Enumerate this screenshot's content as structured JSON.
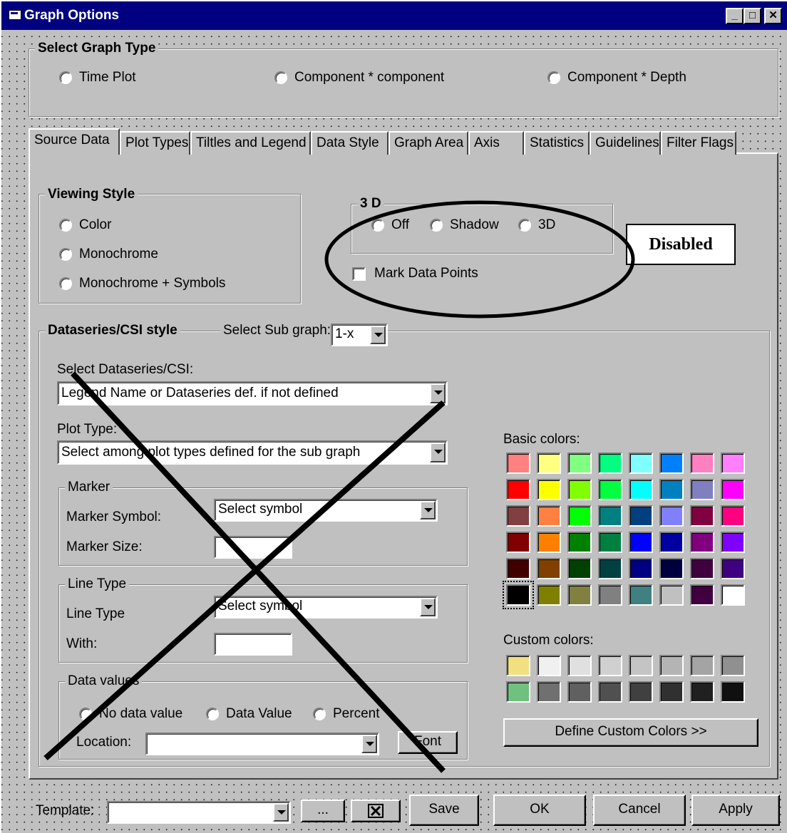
{
  "window": {
    "title": "Graph Options",
    "title_buttons": [
      "minimize-icon",
      "maximize-icon",
      "close-icon"
    ]
  },
  "graph_type": {
    "legend": "Select Graph Type",
    "options": [
      "Time Plot",
      "Component * component",
      "Component * Depth"
    ]
  },
  "tabs": [
    "Source Data",
    "Plot Types",
    "Tiltles and Legend",
    "Data Style",
    "Graph Area",
    "Axis",
    "Statistics",
    "Guidelines",
    "Filter Flags"
  ],
  "active_tab": "Source Data",
  "viewing_style": {
    "legend": "Viewing Style",
    "options": [
      "Color",
      "Monochrome",
      "Monochrome + Symbols"
    ]
  },
  "three_d": {
    "legend": "3 D",
    "options": [
      "Off",
      "Shadow",
      "3D"
    ],
    "mark_points": "Mark Data Points",
    "annotation": "Disabled"
  },
  "dataseries": {
    "legend": "Dataseries/CSI style",
    "sub_graph_label": "Select Sub graph:",
    "sub_graph_value": "1-x",
    "select_label": "Select Dataseries/CSI:",
    "select_value": "Legend Name or Dataseries def. if not defined",
    "plot_type_label": "Plot Type:",
    "plot_type_value": "Select among plot types defined for the sub graph",
    "marker": {
      "legend": "Marker",
      "symbol_label": "Marker Symbol:",
      "symbol_value": "Select symbol",
      "size_label": "Marker Size:"
    },
    "line": {
      "legend": "Line Type",
      "type_label": "Line Type",
      "type_value": "Select symbol",
      "width_label": "With:"
    },
    "data_values": {
      "legend": "Data values",
      "options": [
        "No data value",
        "Data Value",
        "Percent"
      ],
      "location_label": "Location:",
      "font_button": "Font"
    }
  },
  "colors": {
    "basic_label": "Basic colors:",
    "basic": [
      "#ff8080",
      "#ffff80",
      "#80ff80",
      "#00ff80",
      "#80ffff",
      "#0080ff",
      "#ff80c0",
      "#ff80ff",
      "#ff0000",
      "#ffff00",
      "#80ff00",
      "#00ff40",
      "#00ffff",
      "#0080c0",
      "#8080c0",
      "#ff00ff",
      "#804040",
      "#ff8040",
      "#00ff00",
      "#008080",
      "#004080",
      "#8080ff",
      "#800040",
      "#ff0080",
      "#800000",
      "#ff8000",
      "#008000",
      "#008040",
      "#0000ff",
      "#0000a0",
      "#800080",
      "#8000ff",
      "#400000",
      "#804000",
      "#004000",
      "#004040",
      "#000080",
      "#000040",
      "#400040",
      "#400080",
      "#000000",
      "#808000",
      "#808040",
      "#808080",
      "#408080",
      "#c0c0c0",
      "#400040",
      "#ffffff"
    ],
    "custom_label": "Custom colors:",
    "custom": [
      "#f0e080",
      "#f0f0f0",
      "#e0e0e0",
      "#d0d0d0",
      "#c4c4c4",
      "#b4b4b4",
      "#a4a4a4",
      "#909090",
      "#70c080",
      "#707070",
      "#606060",
      "#505050",
      "#404040",
      "#303030",
      "#202020",
      "#101010"
    ],
    "define_button": "Define Custom Colors >>"
  },
  "footer": {
    "template_label": "Template:",
    "browse_button": "...",
    "delete_icon": "delete-x-icon",
    "save_button": "Save",
    "ok_button": "OK",
    "cancel_button": "Cancel",
    "apply_button": "Apply"
  }
}
